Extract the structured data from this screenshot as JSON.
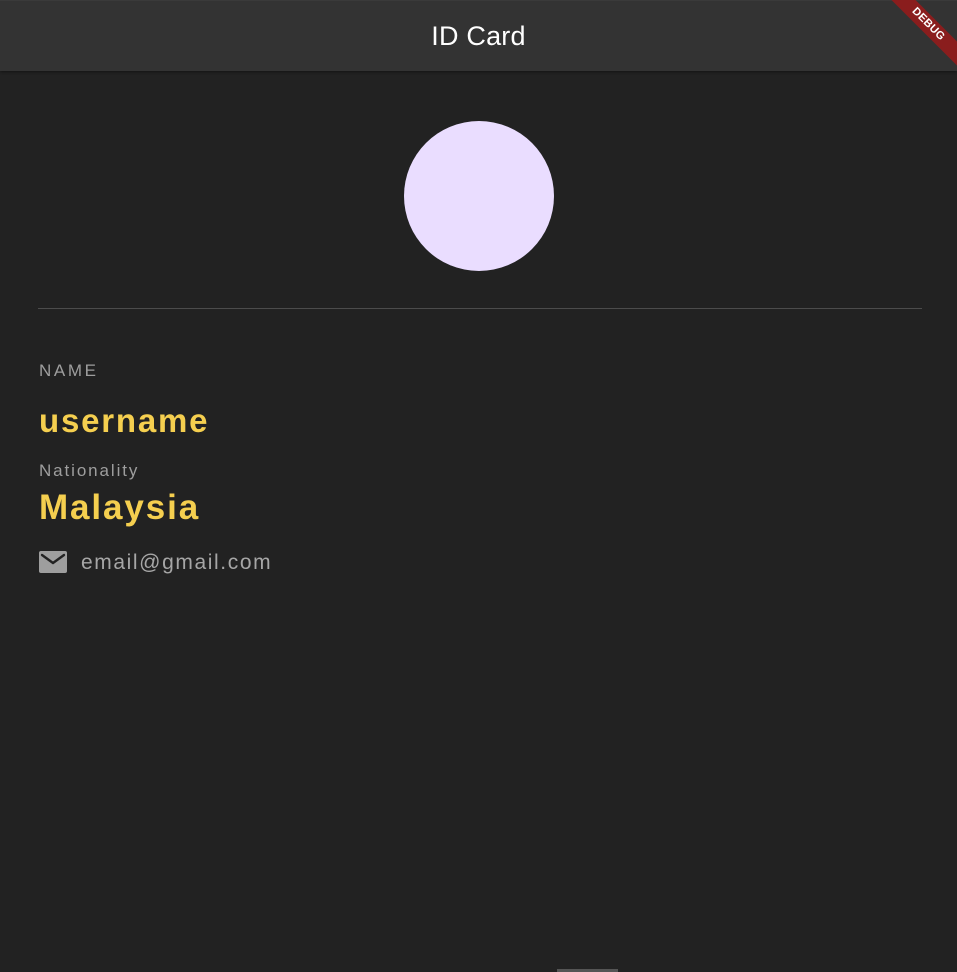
{
  "appbar": {
    "title": "ID Card"
  },
  "debug_banner": {
    "label": "DEBUG"
  },
  "profile": {
    "name_label": "NAME",
    "name_value": "username",
    "nationality_label": "Nationality",
    "nationality_value": "Malaysia",
    "email_icon": "mail-icon",
    "email": "email@gmail.com"
  },
  "colors": {
    "background": "#222222",
    "appbar": "#333333",
    "avatar": "#eaddff",
    "accent_text": "#f5cf4f",
    "muted_text": "#9e9e9e",
    "debug_ribbon": "#8a1d1d"
  }
}
